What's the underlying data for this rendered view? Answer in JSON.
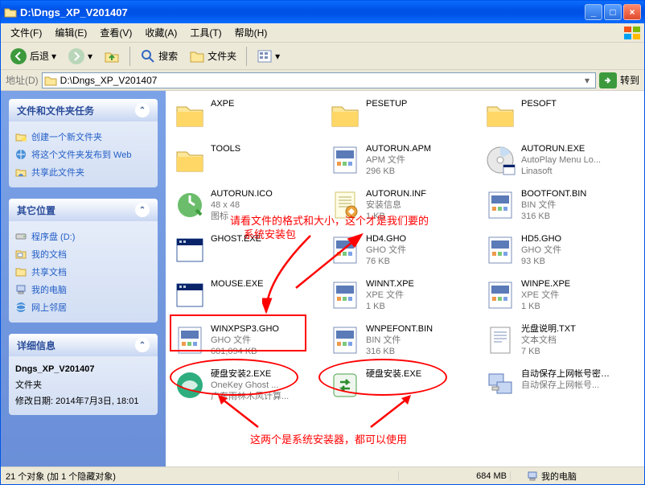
{
  "title": "D:\\Dngs_XP_V201407",
  "menu": [
    "文件(F)",
    "编辑(E)",
    "查看(V)",
    "收藏(A)",
    "工具(T)",
    "帮助(H)"
  ],
  "toolbar": {
    "back": "后退",
    "search": "搜索",
    "folders": "文件夹"
  },
  "address": {
    "label": "地址(D)",
    "path": "D:\\Dngs_XP_V201407",
    "go": "转到"
  },
  "sidebar": {
    "tasks": {
      "title": "文件和文件夹任务",
      "items": [
        "创建一个新文件夹",
        "将这个文件夹发布到 Web",
        "共享此文件夹"
      ]
    },
    "other": {
      "title": "其它位置",
      "items": [
        "程序盘 (D:)",
        "我的文档",
        "共享文档",
        "我的电脑",
        "网上邻居"
      ]
    },
    "details": {
      "title": "详细信息",
      "name": "Dngs_XP_V201407",
      "type": "文件夹",
      "mod": "修改日期: 2014年7月3日, 18:01"
    }
  },
  "files": [
    {
      "name": "AXPE",
      "t": "folder"
    },
    {
      "name": "PESETUP",
      "t": "folder"
    },
    {
      "name": "PESOFT",
      "t": "folder"
    },
    {
      "name": "TOOLS",
      "t": "folder"
    },
    {
      "name": "AUTORUN.APM",
      "sub1": "APM 文件",
      "sub2": "296 KB",
      "t": "binfile"
    },
    {
      "name": "AUTORUN.EXE",
      "sub1": "AutoPlay Menu Lo...",
      "sub2": "Linasoft",
      "t": "disc"
    },
    {
      "name": "AUTORUN.ICO",
      "sub1": "48 x 48",
      "sub2": "图标",
      "t": "icon"
    },
    {
      "name": "AUTORUN.INF",
      "sub1": "安装信息",
      "sub2": "1 KB",
      "t": "inf"
    },
    {
      "name": "BOOTFONT.BIN",
      "sub1": "BIN 文件",
      "sub2": "316 KB",
      "t": "binfile"
    },
    {
      "name": "GHOST.EXE",
      "sub1": "",
      "sub2": "",
      "t": "exe"
    },
    {
      "name": "HD4.GHO",
      "sub1": "GHO 文件",
      "sub2": "76 KB",
      "t": "binfile"
    },
    {
      "name": "HD5.GHO",
      "sub1": "GHO 文件",
      "sub2": "93 KB",
      "t": "binfile"
    },
    {
      "name": "MOUSE.EXE",
      "sub1": "",
      "sub2": "",
      "t": "exe"
    },
    {
      "name": "WINNT.XPE",
      "sub1": "XPE 文件",
      "sub2": "1 KB",
      "t": "binfile"
    },
    {
      "name": "WINPE.XPE",
      "sub1": "XPE 文件",
      "sub2": "1 KB",
      "t": "binfile"
    },
    {
      "name": "WINXPSP3.GHO",
      "sub1": "GHO 文件",
      "sub2": "681,094 KB",
      "t": "binfile"
    },
    {
      "name": "WNPEFONT.BIN",
      "sub1": "BIN 文件",
      "sub2": "316 KB",
      "t": "binfile"
    },
    {
      "name": "光盘说明.TXT",
      "sub1": "文本文档",
      "sub2": "7 KB",
      "t": "txt"
    },
    {
      "name": "硬盘安装2.EXE",
      "sub1": "OneKey Ghost ...",
      "sub2": "广东雨林木风计算...",
      "t": "installer1"
    },
    {
      "name": "硬盘安装.EXE",
      "sub1": "",
      "sub2": "",
      "t": "installer2"
    },
    {
      "name": "自动保存上网帐号密码到D盘.EXE",
      "sub1": "自动保存上网帐号...",
      "sub2": "",
      "t": "netexe"
    }
  ],
  "annotations": {
    "a1": "请看文件的格式和大小，这个才是我们要的",
    "a1b": "系统安装包",
    "a2": "这两个是系统安装器，都可以使用"
  },
  "status": {
    "left": "21 个对象 (加 1 个隐藏对象)",
    "mid": "684 MB",
    "right": "我的电脑"
  }
}
